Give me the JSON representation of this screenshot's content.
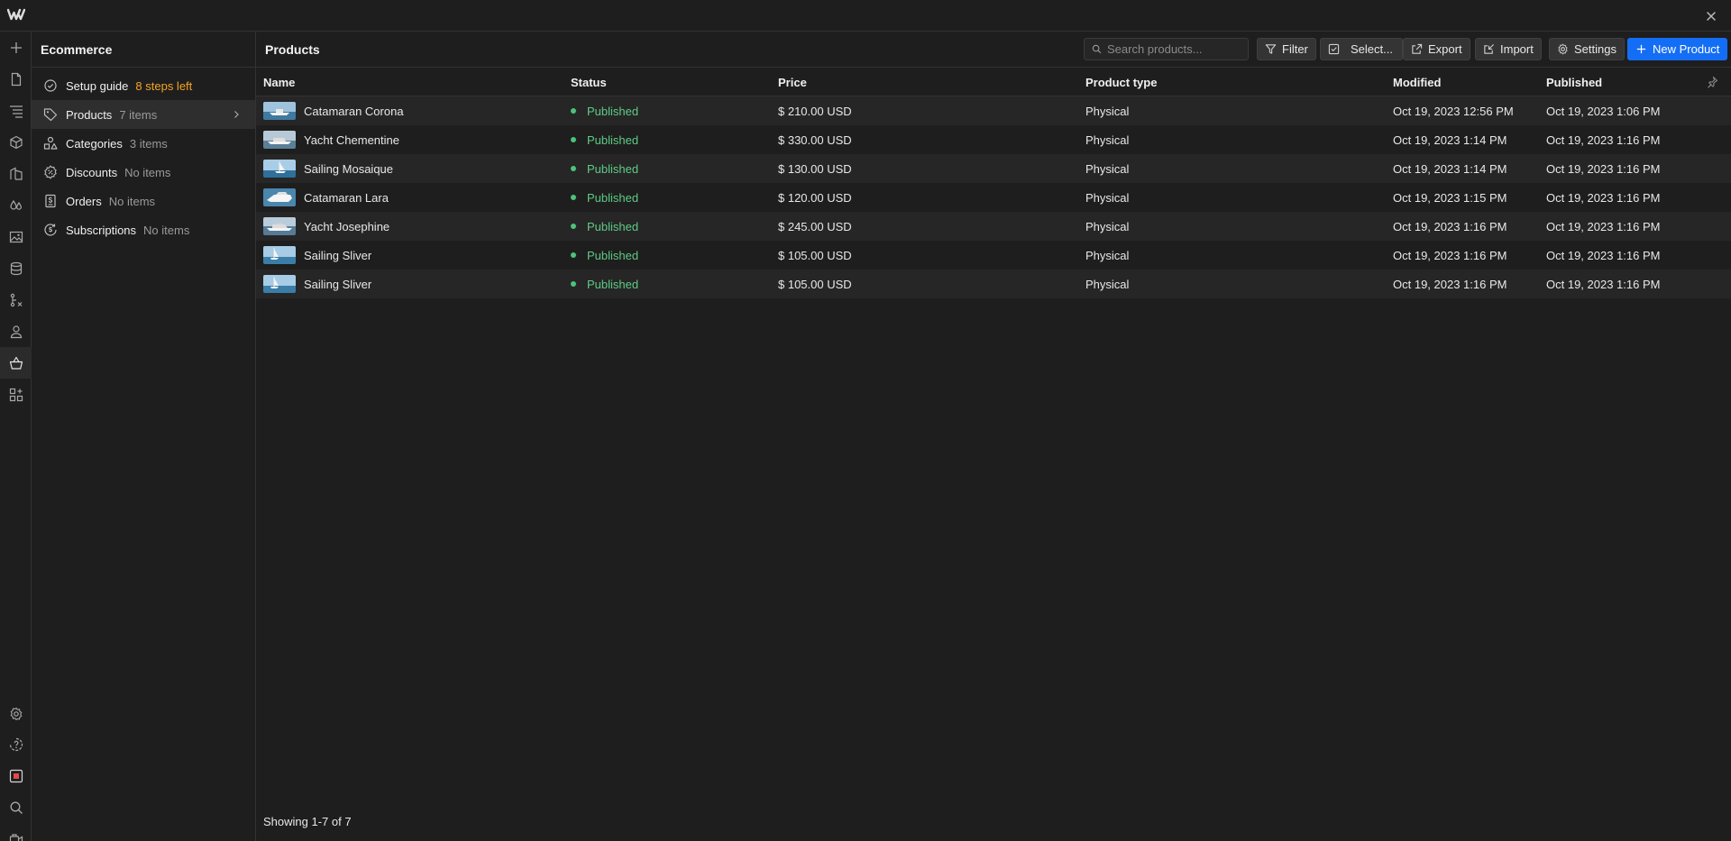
{
  "app": {
    "logo_icon": "webflow-logo-icon",
    "close_icon": "close-icon"
  },
  "rail": {
    "top": [
      {
        "name": "add-icon"
      },
      {
        "name": "page-icon"
      },
      {
        "name": "navigator-icon"
      },
      {
        "name": "components-icon"
      },
      {
        "name": "library-icon"
      },
      {
        "name": "style-drops-icon"
      },
      {
        "name": "assets-image-icon"
      },
      {
        "name": "cms-database-icon"
      },
      {
        "name": "logic-flow-icon"
      },
      {
        "name": "users-icon"
      },
      {
        "name": "ecommerce-basket-icon",
        "active": true
      },
      {
        "name": "apps-icon"
      }
    ],
    "bottom": [
      {
        "name": "settings-icon"
      },
      {
        "name": "help-icon"
      },
      {
        "name": "record-icon"
      },
      {
        "name": "search-icon"
      },
      {
        "name": "video-icon"
      }
    ]
  },
  "sidebar": {
    "title": "Ecommerce",
    "items": [
      {
        "label": "Setup guide",
        "count": "8 steps left",
        "icon": "check-circle-icon"
      },
      {
        "label": "Products",
        "count": "7 items",
        "icon": "tag-icon",
        "active": true
      },
      {
        "label": "Categories",
        "count": "3 items",
        "icon": "categories-icon"
      },
      {
        "label": "Discounts",
        "count": "No items",
        "icon": "discount-icon"
      },
      {
        "label": "Orders",
        "count": "No items",
        "icon": "orders-icon"
      },
      {
        "label": "Subscriptions",
        "count": "No items",
        "icon": "subscriptions-icon"
      }
    ]
  },
  "main": {
    "title": "Products",
    "search_placeholder": "Search products...",
    "buttons": {
      "filter": "Filter",
      "select": "Select...",
      "export": "Export",
      "import": "Import",
      "settings": "Settings",
      "new_product": "New Product"
    },
    "columns": [
      "Name",
      "Status",
      "Price",
      "Product type",
      "Modified",
      "Published"
    ],
    "rows": [
      {
        "name": "Catamaran Corona",
        "status": "Published",
        "price": "$ 210.00 USD",
        "type": "Physical",
        "modified": "Oct 19, 2023 12:56 PM",
        "published": "Oct 19, 2023 1:06 PM"
      },
      {
        "name": "Yacht Chementine",
        "status": "Published",
        "price": "$ 330.00 USD",
        "type": "Physical",
        "modified": "Oct 19, 2023 1:14 PM",
        "published": "Oct 19, 2023 1:16 PM"
      },
      {
        "name": "Sailing Mosaique",
        "status": "Published",
        "price": "$ 130.00 USD",
        "type": "Physical",
        "modified": "Oct 19, 2023 1:14 PM",
        "published": "Oct 19, 2023 1:16 PM"
      },
      {
        "name": "Catamaran Lara",
        "status": "Published",
        "price": "$ 120.00 USD",
        "type": "Physical",
        "modified": "Oct 19, 2023 1:15 PM",
        "published": "Oct 19, 2023 1:16 PM"
      },
      {
        "name": "Yacht Josephine",
        "status": "Published",
        "price": "$ 245.00 USD",
        "type": "Physical",
        "modified": "Oct 19, 2023 1:16 PM",
        "published": "Oct 19, 2023 1:16 PM"
      },
      {
        "name": "Sailing Sliver",
        "status": "Published",
        "price": "$ 105.00 USD",
        "type": "Physical",
        "modified": "Oct 19, 2023 1:16 PM",
        "published": "Oct 19, 2023 1:16 PM"
      },
      {
        "name": "Sailing Sliver",
        "status": "Published",
        "price": "$ 105.00 USD",
        "type": "Physical",
        "modified": "Oct 19, 2023 1:16 PM",
        "published": "Oct 19, 2023 1:16 PM"
      }
    ],
    "footer": "Showing 1-7 of 7"
  },
  "colors": {
    "accent": "#146ef5",
    "published": "#5ecb84",
    "warning": "#f5a524"
  }
}
